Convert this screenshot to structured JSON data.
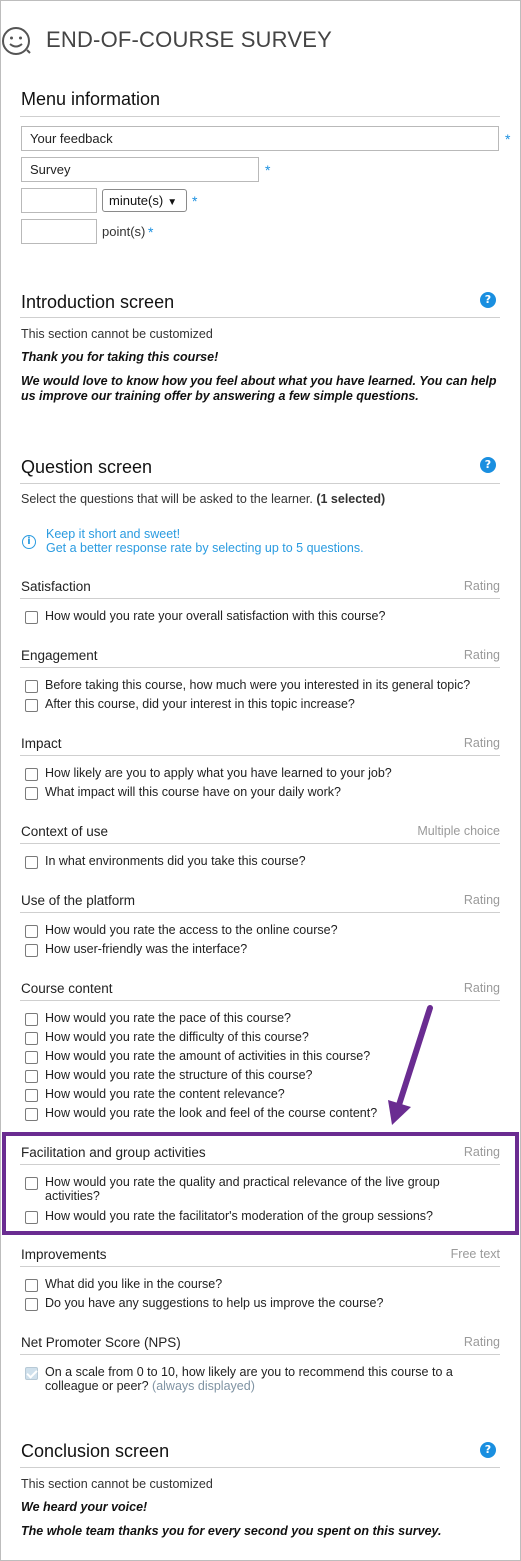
{
  "app": {
    "title": "END-OF-COURSE SURVEY",
    "logo_icon": "smiley-icon"
  },
  "menu": {
    "title": "Menu information",
    "feedback_value": "Your feedback",
    "survey_value": "Survey",
    "duration_value": "",
    "duration_unit": "minute(s)",
    "points_value": "",
    "points_unit": "point(s)",
    "required_mark": "*"
  },
  "intro": {
    "title": "Introduction screen",
    "note": "This section cannot be customized",
    "line1": "Thank you for taking this course!",
    "line2": "We would love to know how you feel about what you have learned. You can help us improve our training offer by answering a few simple questions."
  },
  "questions": {
    "title": "Question screen",
    "instruction": "Select the questions that will be asked to the learner.",
    "selected": "(1 selected)",
    "tip1": "Keep it short and sweet!",
    "tip2": "Get a better response rate by selecting up to 5 questions.",
    "categories": {
      "satisfaction": {
        "title": "Satisfaction",
        "type": "Rating",
        "items": [
          "How would you rate your overall satisfaction with this course?"
        ]
      },
      "engagement": {
        "title": "Engagement",
        "type": "Rating",
        "items": [
          "Before taking this course, how much were you interested in its general topic?",
          "After this course, did your interest in this topic increase?"
        ]
      },
      "impact": {
        "title": "Impact",
        "type": "Rating",
        "items": [
          "How likely are you to apply what you have learned to your job?",
          "What impact will this course have on your daily work?"
        ]
      },
      "context": {
        "title": "Context of use",
        "type": "Multiple choice",
        "items": [
          "In what environments did you take this course?"
        ]
      },
      "platform": {
        "title": "Use of the platform",
        "type": "Rating",
        "items": [
          "How would you rate the access to the online course?",
          "How user-friendly was the interface?"
        ]
      },
      "content": {
        "title": "Course content",
        "type": "Rating",
        "items": [
          "How would you rate the pace of this course?",
          "How would you rate the difficulty of this course?",
          "How would you rate the amount of activities in this course?",
          "How would you rate the structure of this course?",
          "How would you rate the content relevance?",
          "How would you rate the look and feel of the course content?"
        ]
      },
      "facilitation": {
        "title": "Facilitation and group activities",
        "type": "Rating",
        "items": [
          "How would you rate the quality and practical relevance of the live group activities?",
          "How would you rate the facilitator's moderation of the group sessions?"
        ]
      },
      "improvements": {
        "title": "Improvements",
        "type": "Free text",
        "items": [
          "What did you like in the course?",
          "Do you have any suggestions to help us improve the course?"
        ]
      },
      "nps": {
        "title": "Net Promoter Score (NPS)",
        "type": "Rating",
        "item": "On a scale from 0 to 10, how likely are you to recommend this course to a colleague or peer?",
        "always": "(always displayed)"
      }
    }
  },
  "conclusion": {
    "title": "Conclusion screen",
    "note": "This section cannot be customized",
    "line1": "We heard your voice!",
    "line2": "The whole team thanks you for every second you spent on this survey."
  },
  "annotation": {
    "arrow_color": "#6a2c91",
    "box_color": "#6a2c91"
  },
  "colors": {
    "accent": "#1a8fe0",
    "tip": "#2a9be0"
  }
}
